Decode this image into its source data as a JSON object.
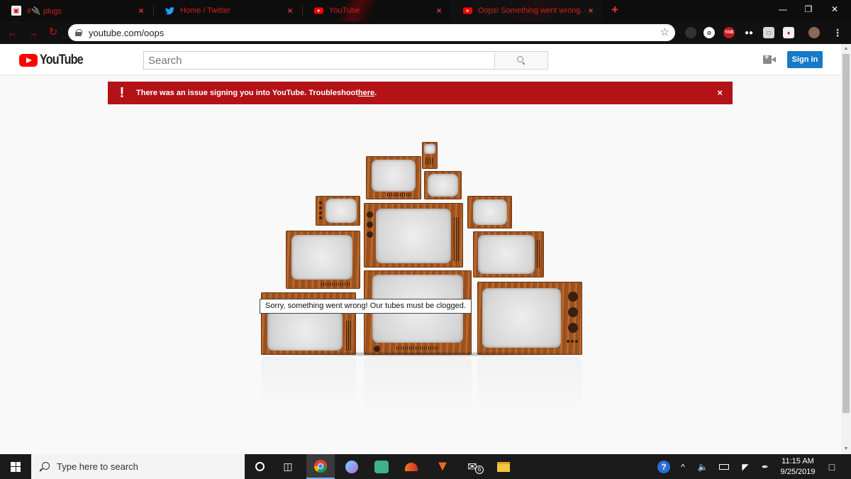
{
  "browser": {
    "tabs": [
      {
        "title": "#🔌 plugs",
        "icon": "discord-icon"
      },
      {
        "title": "Home / Twitter",
        "icon": "twitter-icon"
      },
      {
        "title": "YouTube",
        "icon": "youtube-icon"
      },
      {
        "title": "Oops! Something went wrong. -",
        "icon": "youtube-icon"
      }
    ],
    "url": "youtube.com/oops",
    "extensions": [
      "avatar-extension",
      "blocker-extension",
      "yab-extension",
      "mask-extension",
      "kanji-extension",
      "puzzle-extension",
      "profile-avatar"
    ],
    "extension_yab_label": "YAB",
    "accent": "#d21f1f"
  },
  "youtube": {
    "logo_text": "YouTube",
    "search_placeholder": "Search",
    "signin_label": "Sign in",
    "alert": {
      "message": "There was an issue signing you into YouTube. Troubleshoot ",
      "link": "here",
      "suffix": ".",
      "close": "×",
      "color": "#b31217"
    },
    "error_tooltip": "Sorry, something went wrong! Our tubes must be clogged."
  },
  "taskbar": {
    "search_placeholder": "Type here to search",
    "apps": [
      "cortana",
      "task-view",
      "chrome",
      "edge-dev",
      "app-game",
      "fox-app",
      "brave",
      "mail",
      "file-explorer"
    ],
    "mail_badge": "6",
    "time": "11:15 AM",
    "date": "9/25/2019"
  }
}
